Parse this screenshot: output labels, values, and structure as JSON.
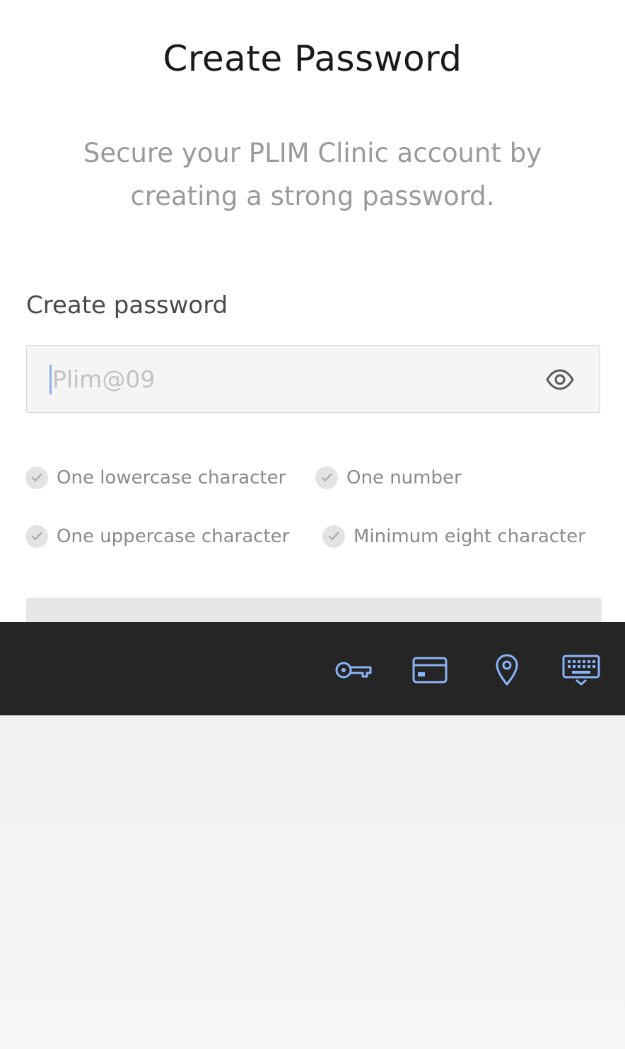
{
  "page": {
    "title": "Create Password",
    "subtitle": "Secure your PLIM Clinic account by creating a strong password."
  },
  "form": {
    "password_label": "Create password",
    "password_placeholder": "Plim@09",
    "password_value": "",
    "visibility_icon": "eye-icon"
  },
  "requirements": [
    {
      "label": "One lowercase character",
      "met": false
    },
    {
      "label": "One number",
      "met": false
    },
    {
      "label": "One uppercase character",
      "met": false
    },
    {
      "label": "Minimum eight character",
      "met": false
    }
  ],
  "keyboard_toolbar": {
    "icons": [
      "key-icon",
      "credit-card-icon",
      "location-pin-icon",
      "keyboard-icon"
    ],
    "accent_color": "#8ab4f8",
    "background_color": "#252525"
  }
}
